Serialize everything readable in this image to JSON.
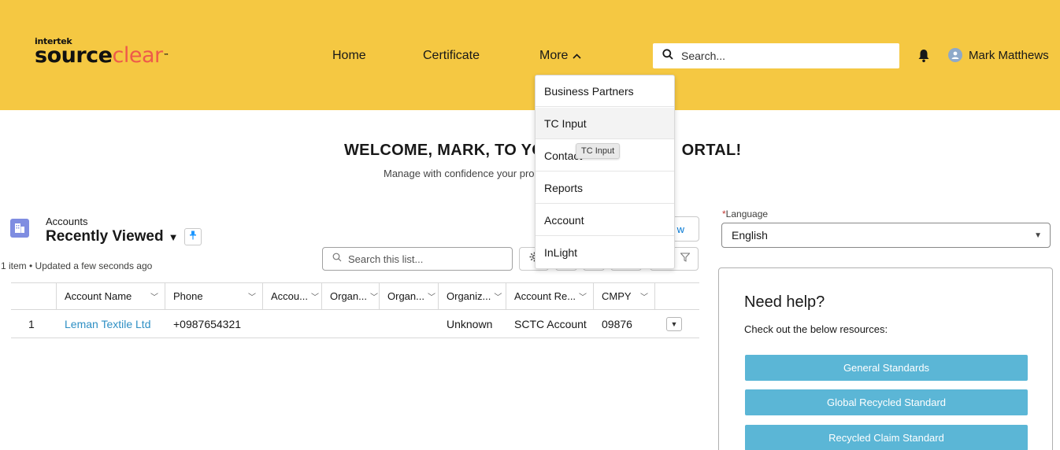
{
  "header": {
    "logo_small": "intertek",
    "logo_word1": "source",
    "logo_word2": "clear",
    "logo_tm": "™",
    "nav": {
      "home": "Home",
      "certificate": "Certificate",
      "more": "More"
    },
    "search_placeholder": "Search...",
    "user_name": "Mark Matthews",
    "bg_color": "#f5c842"
  },
  "welcome": {
    "title": "WELCOME, MARK, TO YOUR",
    "title_tail": "ORTAL!",
    "subtitle": "Manage with confidence your pro",
    "subtitle_tail": "s"
  },
  "more_menu": {
    "items": [
      "Business Partners",
      "TC Input",
      "Contact",
      "Reports",
      "Account",
      "InLight"
    ],
    "tooltip": "TC Input"
  },
  "list": {
    "object_label": "Accounts",
    "view_name": "Recently Viewed",
    "meta": "1 item • Updated a few seconds ago",
    "search_placeholder": "Search this list...",
    "new_button_tail": "w",
    "columns": [
      "Account Name",
      "Phone",
      "Accou...",
      "Organ...",
      "Organ...",
      "Organiz...",
      "Account Re...",
      "CMPY"
    ],
    "rows": [
      {
        "num": "1",
        "account_name": "Leman Textile Ltd",
        "phone": "+0987654321",
        "c3": "",
        "c4": "",
        "c5": "",
        "organization": "Unknown",
        "record_type": "SCTC Account",
        "cmpy": "09876"
      }
    ]
  },
  "language": {
    "label": "Language",
    "required_mark": "*",
    "value": "English"
  },
  "help": {
    "title": "Need help?",
    "subtitle": "Check out the below resources:",
    "buttons": [
      "General Standards",
      "Global Recycled Standard",
      "Recycled Claim Standard"
    ]
  }
}
